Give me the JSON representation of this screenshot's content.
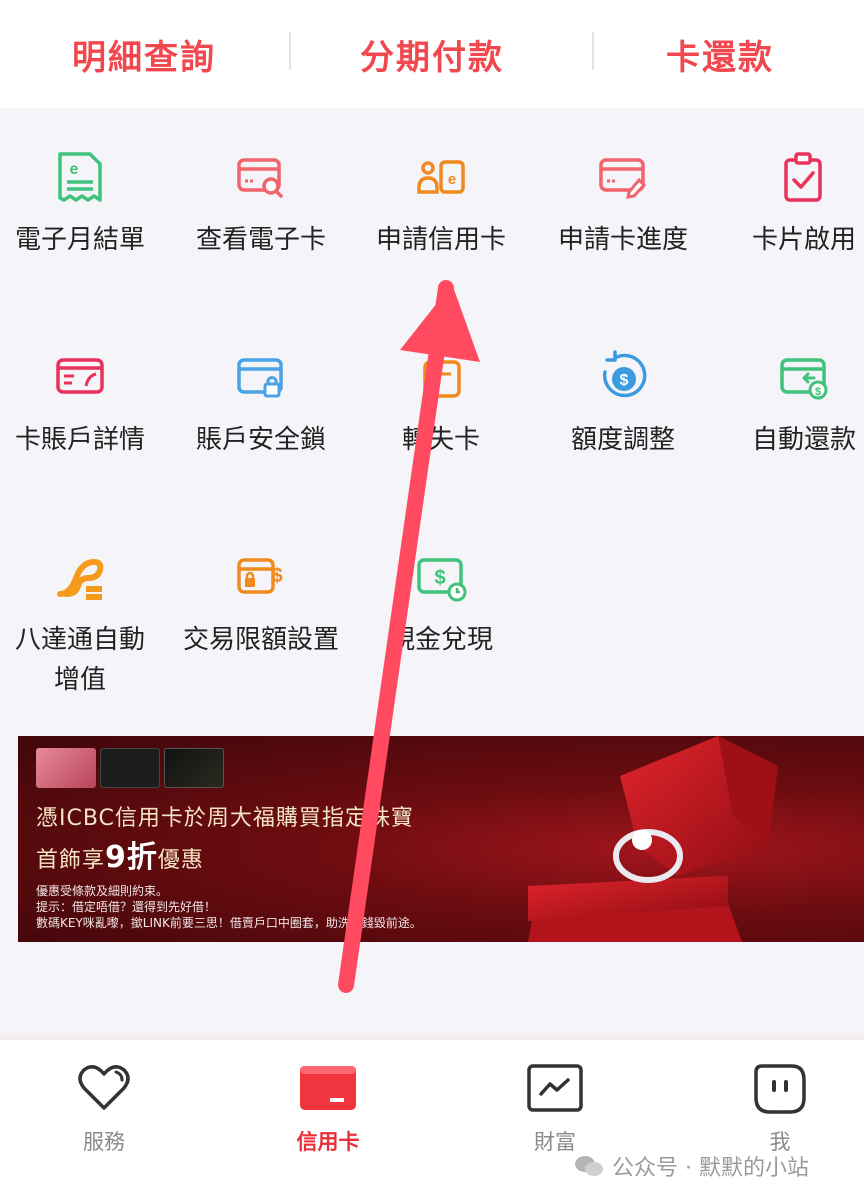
{
  "top_tabs": [
    "明細查詢",
    "分期付款",
    "卡還款"
  ],
  "grid": {
    "row1": [
      "電子月結單",
      "查看電子卡",
      "申請信用卡",
      "申請卡進度",
      "卡片啟用"
    ],
    "row2": [
      "卡賬戶詳情",
      "賬戶安全鎖",
      "轉失卡",
      "額度調整",
      "自動還款"
    ],
    "row3_item1_line1": "八達通自動",
    "row3_item1_line2": "增值",
    "row3_item2": "交易限額設置",
    "row3_item3": "現金兌現"
  },
  "banner": {
    "headline": "憑ICBC信用卡於周大福購買指定珠寶",
    "subline_prefix": "首飾享",
    "subline_discount": "9折",
    "subline_suffix": "優惠",
    "fine_print": [
      "優惠受條款及細則約束。",
      "提示：借定唔借？還得到先好借！",
      "數碼KEY咪亂嚟，撳LINK前要三思！借賣戶口中圈套，助洗黑錢毀前途。"
    ]
  },
  "bottom_nav": [
    "服務",
    "信用卡",
    "財富",
    "我"
  ],
  "watermark": "公众号 · 默默的小站",
  "colors": {
    "brand_red": "#f1474f",
    "nav_active": "#e8303a",
    "arrow": "#ff4a60"
  }
}
